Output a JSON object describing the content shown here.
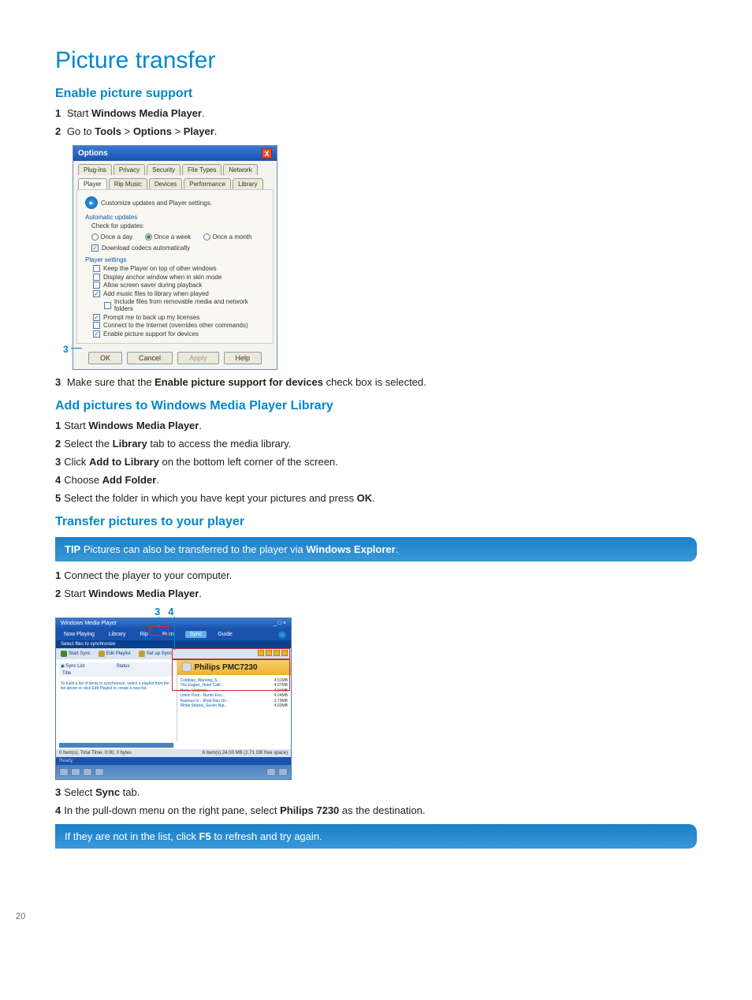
{
  "page_number": "20",
  "h1": "Picture transfer",
  "h2_enable": "Enable picture support",
  "h2_add": "Add pictures to Windows Media Player Library",
  "h2_transfer": "Transfer pictures to your player",
  "enable_steps": {
    "s1": {
      "num": "1",
      "pre": "Start ",
      "b": "Windows Media Player",
      "post": "."
    },
    "s2": {
      "num": "2",
      "pre": "Go to ",
      "b1": "Tools",
      "gt1": " > ",
      "b2": "Options",
      "gt2": " > ",
      "b3": "Player",
      "post": "."
    },
    "s3": {
      "num": "3",
      "pre": "Make sure that the ",
      "b": "Enable picture support for devices",
      "post": " check box is selected."
    },
    "marker3": "3"
  },
  "dialog": {
    "title": "Options",
    "close_x": "X",
    "tabs_row1": [
      "Plug-ins",
      "Privacy",
      "Security",
      "File Types",
      "Network"
    ],
    "tabs_row2": [
      "Player",
      "Rip Music",
      "Devices",
      "Performance",
      "Library"
    ],
    "banner": "Customize updates and Player settings.",
    "grp_auto": "Automatic updates",
    "check_for": "Check for updates:",
    "radios": [
      "Once a day",
      "Once a week",
      "Once a month"
    ],
    "dl_codecs": "Download codecs automatically",
    "grp_player": "Player settings",
    "opts": [
      "Keep the Player on top of other windows",
      "Display anchor window when in skin mode",
      "Allow screen saver during playback",
      "Add music files to library when played",
      "Include files from removable media and network folders",
      "Prompt me to back up my licenses",
      "Connect to the Internet (overrides other commands)",
      "Enable picture support for devices"
    ],
    "btn_ok": "OK",
    "btn_cancel": "Cancel",
    "btn_apply": "Apply",
    "btn_help": "Help"
  },
  "add_steps": {
    "s1": {
      "num": "1",
      "pre": "Start ",
      "b": "Windows Media Player",
      "post": "."
    },
    "s2": {
      "num": "2",
      "pre": "Select the ",
      "b": "Library",
      "post": " tab to access the media library."
    },
    "s3": {
      "num": "3",
      "pre": "Click ",
      "b": "Add to Library",
      "post": " on the bottom left corner of the screen."
    },
    "s4": {
      "num": "4",
      "pre": "Choose ",
      "b": "Add Folder",
      "post": "."
    },
    "s5": {
      "num": "5",
      "pre": "Select the folder in which you have kept your pictures and press ",
      "b": "OK",
      "post": "."
    }
  },
  "tip1": {
    "label": "TIP",
    "pre": " Pictures can also be transferred to the player via ",
    "b": "Windows Explorer",
    "post": "."
  },
  "tip2": {
    "pre": "If they are not in the list, click ",
    "b": "F5",
    "post": " to refresh and try again."
  },
  "transfer_steps": {
    "s1": {
      "num": "1",
      "pre": "Connect the player to your computer."
    },
    "s2": {
      "num": "2",
      "pre": "Start ",
      "b": "Windows Media Player",
      "post": "."
    },
    "s3": {
      "num": "3",
      "pre": "Select ",
      "b": "Sync",
      "post": " tab."
    },
    "s4": {
      "num": "4",
      "pre": "In the pull-down menu on the right pane, select ",
      "b": "Philips 7230",
      "post": " as the destination."
    },
    "m3": "3",
    "m4": "4"
  },
  "wmp": {
    "title": "Windows Media Player",
    "tabs": [
      "Now Playing",
      "Library",
      "Rip",
      "Burn",
      "Sync",
      "Guide"
    ],
    "bar": "Select files to synchronize",
    "tool": [
      "Start Sync",
      "Edit Playlist",
      "Set up Sync"
    ],
    "left_hdr": [
      "Sync List",
      "Status"
    ],
    "left_title": "Title",
    "left_msg": "To build a list of items to synchronize, select a playlist from the list above or click Edit Playlist to create a new list.",
    "right_hdr": "Philips PMC7230",
    "list": [
      [
        "Coldplay_Warning_S...",
        "4.01MB"
      ],
      [
        "The Eagles_Hotel Calif...",
        "4.07MB"
      ],
      [
        "Hurts_Unspeak...",
        "4.04MB"
      ],
      [
        "Linkin Park - Numb Enc...",
        "4.04MB"
      ],
      [
        "Rasmus In - Shad Rou Un...",
        "3.79MB"
      ],
      [
        "White Stripes_Seven Nat...",
        "4.03MB"
      ]
    ],
    "foot_left": "0 Item(s), Total Time: 0:00, 0 bytes",
    "foot_right": "6 Item(s) 24.00 MB (2.71 GB free space)",
    "ready": "Ready"
  }
}
